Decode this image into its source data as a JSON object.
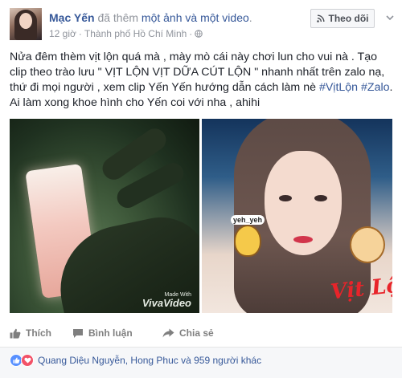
{
  "post": {
    "author": "Mạc Yến",
    "action_text": "đã thêm",
    "action_link": "một ảnh và một video",
    "period": ".",
    "time": "12 giờ",
    "location": "Thành phố Hồ Chí Minh",
    "separator": "·",
    "follow_button": "Theo dõi",
    "text_main": "Nửa đêm thèm vịt lộn quá mà , mày mò cái này chơi lun cho vui nà . Tạo clip theo trào lưu \" VỊT LỘN VỊT DỮA CÚT LỘN \" nhanh nhất trên zalo nạ, thứ đi mọi người , xem clip Yến Yến hướng dẫn cách làm nè",
    "hashtag1": "#VịtLộn",
    "hashtag2": "#Zalo",
    "text_end": ". Ai làm xong khoe hình cho Yến coi với nha , ahihi"
  },
  "media": {
    "watermark_small": "Made With",
    "watermark_big": "VivaVideo",
    "sticker_text": "yeh_yeh",
    "sticker_caption": "Vịt Lộn"
  },
  "actions": {
    "like": "Thích",
    "comment": "Bình luận",
    "share": "Chia sẻ"
  },
  "reactions": {
    "names": "Quang Diệu Nguyễn, Hong Phuc và 959 người khác"
  },
  "icons": {
    "globe": "globe-icon",
    "follow": "rss-icon",
    "chevron": "chevron-down-icon",
    "like": "thumbs-up-icon",
    "comment": "comment-icon",
    "share": "share-icon",
    "react_like": "like-reaction-icon",
    "react_love": "love-reaction-icon"
  },
  "colors": {
    "link": "#365899",
    "meta": "#90949c",
    "like_blue": "#5890ff",
    "love_red": "#f25268"
  }
}
